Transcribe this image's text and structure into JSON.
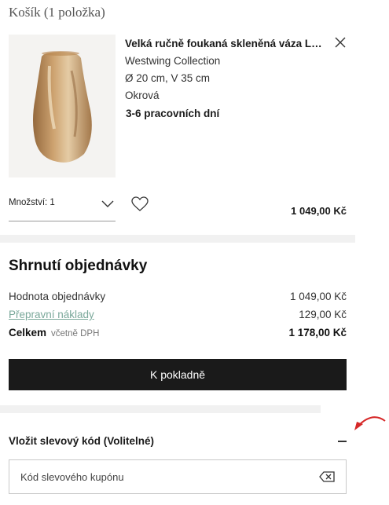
{
  "cart": {
    "title": "Košík (1 položka)"
  },
  "item": {
    "name": "Velká ručně foukaná skleněná váza Lu...",
    "brand": "Westwing Collection",
    "dimensions": "Ø 20 cm, V 35 cm",
    "color": "Okrová",
    "delivery": "3-6 pracovních dní",
    "quantity_label": "Množství: 1",
    "price": "1 049,00 Kč",
    "icons": {
      "remove": "close-icon",
      "quantity": "chevron-down-icon",
      "wishlist": "heart-icon"
    }
  },
  "summary": {
    "title": "Shrnutí objednávky",
    "order_value_label": "Hodnota objednávky",
    "order_value": "1 049,00 Kč",
    "shipping_label": "Přepravní náklady",
    "shipping_value": "129,00 Kč",
    "total_label": "Celkem",
    "total_vat_note": "včetně DPH",
    "total_value": "1 178,00 Kč",
    "checkout_label": "K pokladně"
  },
  "coupon": {
    "toggle_label": "Vložit slevový kód (Volitelné)",
    "input_placeholder": "Kód slevového kupónu",
    "icons": {
      "toggle": "minus-icon",
      "clear": "backspace-clear-icon"
    }
  },
  "colors": {
    "primary_button": "#1a1a1a",
    "link": "#7aa89a",
    "annotation_arrow": "#d62828"
  }
}
